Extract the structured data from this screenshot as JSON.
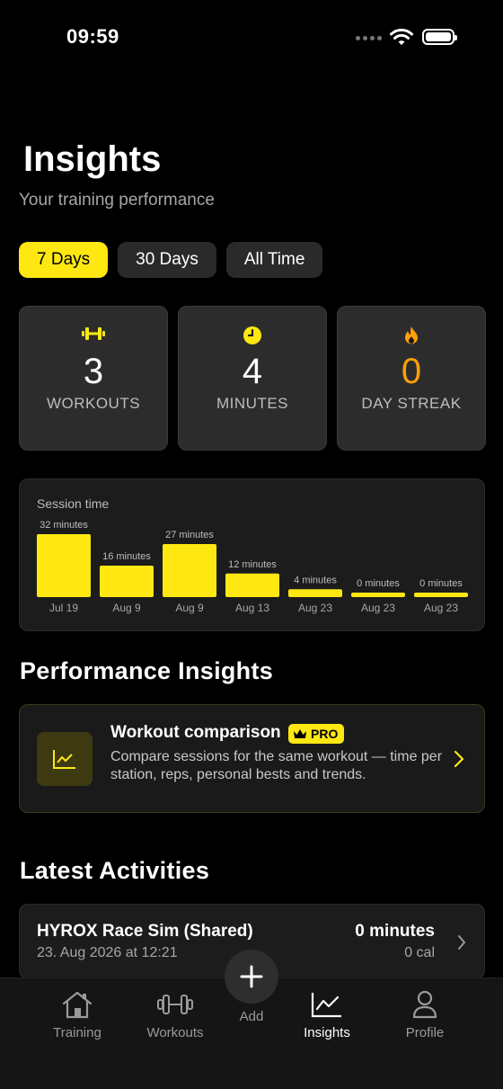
{
  "status_bar": {
    "time": "09:59"
  },
  "header": {
    "title": "Insights",
    "subtitle": "Your training performance"
  },
  "range_tabs": [
    {
      "label": "7 Days",
      "active": true
    },
    {
      "label": "30 Days",
      "active": false
    },
    {
      "label": "All Time",
      "active": false
    }
  ],
  "stats": [
    {
      "icon": "dumbbell-icon",
      "value": "3",
      "label": "WORKOUTS",
      "color": "#ffe812"
    },
    {
      "icon": "clock-icon",
      "value": "4",
      "label": "MINUTES",
      "color": "#ffe812"
    },
    {
      "icon": "flame-icon",
      "value": "0",
      "label": "DAY STREAK",
      "color": "#ff9f0a"
    }
  ],
  "chart_data": {
    "type": "bar",
    "title": "Session time",
    "categories": [
      "Jul 19",
      "Aug 9",
      "Aug 9",
      "Aug 13",
      "Aug 23",
      "Aug 23",
      "Aug 23"
    ],
    "values": [
      32,
      16,
      27,
      12,
      4,
      0,
      0
    ],
    "value_labels": [
      "32 minutes",
      "16 minutes",
      "27 minutes",
      "12 minutes",
      "4 minutes",
      "0 minutes",
      "0 minutes"
    ],
    "bar_color": "#ffe812"
  },
  "performance": {
    "section_title": "Performance Insights",
    "card_title": "Workout comparison",
    "badge": "PRO",
    "description": "Compare sessions for the same workout — time per station, reps, personal bests and trends."
  },
  "activities": {
    "section_title": "Latest Activities",
    "items": [
      {
        "name": "HYROX Race Sim (Shared)",
        "date": "23. Aug 2026 at 12:21",
        "duration": "0 minutes",
        "calories": "0 cal"
      }
    ]
  },
  "tabbar": {
    "items": [
      {
        "label": "Training",
        "icon": "house-icon",
        "active": false
      },
      {
        "label": "Workouts",
        "icon": "dumbbell-icon",
        "active": false
      },
      {
        "label": "Add",
        "icon": "plus-icon",
        "active": false
      },
      {
        "label": "Insights",
        "icon": "chart-icon",
        "active": true
      },
      {
        "label": "Profile",
        "icon": "person-icon",
        "active": false
      }
    ]
  },
  "colors": {
    "accent": "#ffe812",
    "orange": "#ff9f0a",
    "background": "#000000"
  }
}
